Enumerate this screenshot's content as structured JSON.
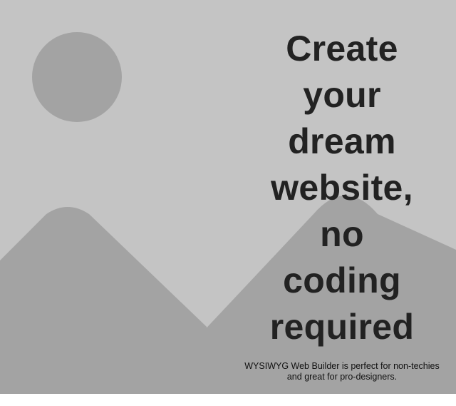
{
  "hero": {
    "headline": "Create\nyour\ndream\nwebsite,\nno\ncoding\nrequired",
    "tagline": "WYSIWYG Web Builder is perfect for non-techies\nand great for pro-designers.",
    "image_icon": "image-placeholder-icon"
  },
  "colors": {
    "background": "#c4c4c4",
    "shapes": "#a3a3a3",
    "headline_text": "#222222",
    "tagline_text": "#111111"
  }
}
